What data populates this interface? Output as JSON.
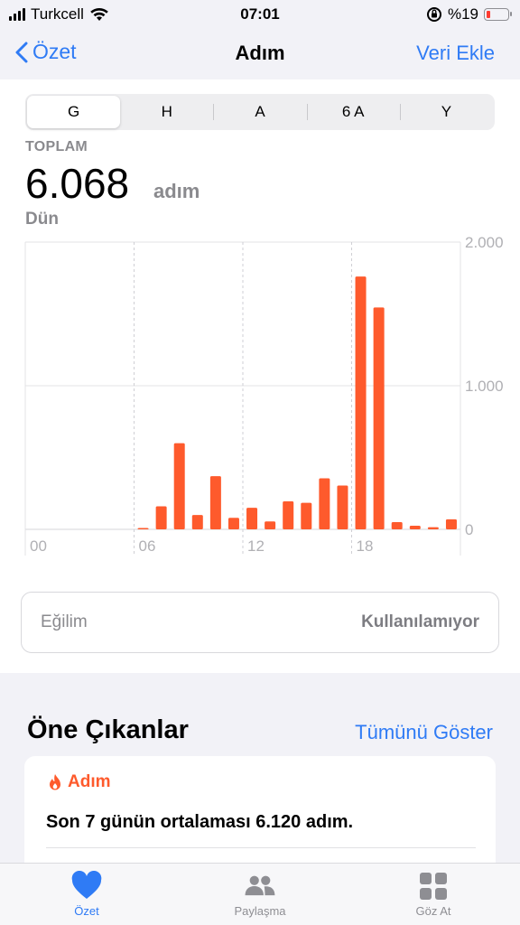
{
  "status_bar": {
    "carrier": "Turkcell",
    "time": "07:01",
    "battery": "%19",
    "battery_level": 0.19
  },
  "nav": {
    "back_label": "Özet",
    "title": "Adım",
    "action_label": "Veri Ekle"
  },
  "segments": [
    {
      "label": "G",
      "selected": true
    },
    {
      "label": "H",
      "selected": false
    },
    {
      "label": "A",
      "selected": false
    },
    {
      "label": "6 A",
      "selected": false
    },
    {
      "label": "Y",
      "selected": false
    }
  ],
  "summary": {
    "label": "TOPLAM",
    "value": "6.068",
    "unit": "adım",
    "date": "Dün"
  },
  "chart_data": {
    "type": "bar",
    "x_ticks": [
      "00",
      "06",
      "12",
      "18"
    ],
    "y_ticks": [
      "2.000",
      "1.000",
      "0"
    ],
    "ylim": [
      0,
      2000
    ],
    "hours": [
      0,
      1,
      2,
      3,
      4,
      5,
      6,
      7,
      8,
      9,
      10,
      11,
      12,
      13,
      14,
      15,
      16,
      17,
      18,
      19,
      20,
      21,
      22,
      23
    ],
    "values": [
      0,
      0,
      0,
      0,
      0,
      0,
      8,
      160,
      600,
      100,
      370,
      80,
      150,
      55,
      195,
      185,
      355,
      305,
      1760,
      1545,
      50,
      25,
      15,
      70
    ],
    "color": "#fe5a2c"
  },
  "trend": {
    "label": "Eğilim",
    "value": "Kullanılamıyor"
  },
  "highlights": {
    "title": "Öne Çıkanlar",
    "link": "Tümünü Göster",
    "card": {
      "category": "Adım",
      "text": "Son 7 günün ortalaması 6.120 adım."
    }
  },
  "tabs": [
    {
      "label": "Özet",
      "icon": "heart-icon",
      "active": true
    },
    {
      "label": "Paylaşma",
      "icon": "people-icon",
      "active": false
    },
    {
      "label": "Göz At",
      "icon": "grid-icon",
      "active": false
    }
  ],
  "colors": {
    "accent": "#2f7bf5",
    "steps": "#fe5a2c"
  }
}
